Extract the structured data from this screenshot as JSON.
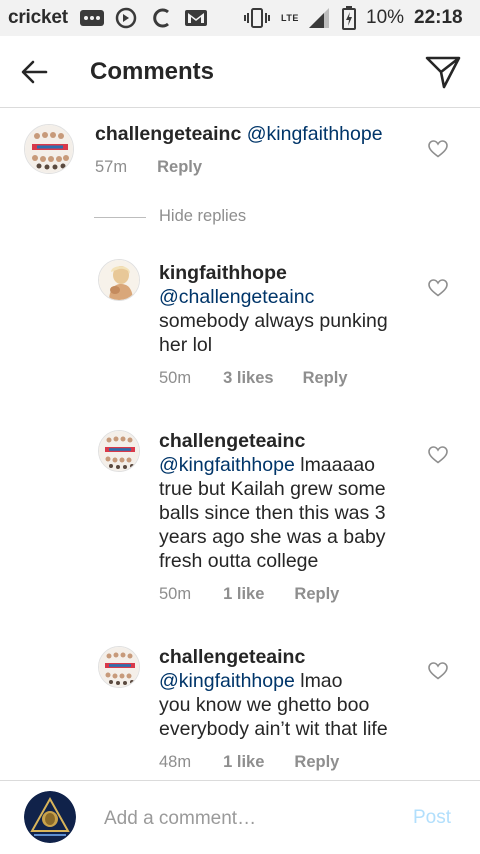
{
  "status_bar": {
    "carrier": "cricket",
    "network": "LTE",
    "battery": "10%",
    "time": "22:18"
  },
  "header": {
    "title": "Comments"
  },
  "comments": [
    {
      "username": "challengeteainc",
      "mention": "@kingfaithhope",
      "text": "",
      "time": "57m",
      "likes": "",
      "reply": "Reply"
    }
  ],
  "hide_replies": "Hide replies",
  "replies": [
    {
      "username": "kingfaithhope",
      "mention": "@challengeteainc",
      "text_lines": [
        "somebody always punking",
        "her lol"
      ],
      "time": "50m",
      "likes": "3 likes",
      "reply": "Reply"
    },
    {
      "username": "challengeteainc",
      "mention": "@kingfaithhope",
      "first_line_rest": " lmaaaao",
      "text_lines": [
        "true but Kailah grew some",
        "balls since then this was 3",
        "years ago she was a baby",
        "fresh outta college"
      ],
      "time": "50m",
      "likes": "1 like",
      "reply": "Reply"
    },
    {
      "username": "challengeteainc",
      "mention": "@kingfaithhope",
      "first_line_rest": " lmao",
      "text_lines": [
        "you know we ghetto boo",
        "everybody ain’t wit that life"
      ],
      "time": "48m",
      "likes": "1 like",
      "reply": "Reply"
    }
  ],
  "add_comment": {
    "placeholder": "Add a comment…",
    "post": "Post"
  },
  "colors": {
    "mention": "#003569",
    "meta": "#8e8e8e",
    "post_disabled": "#b2dffc"
  }
}
